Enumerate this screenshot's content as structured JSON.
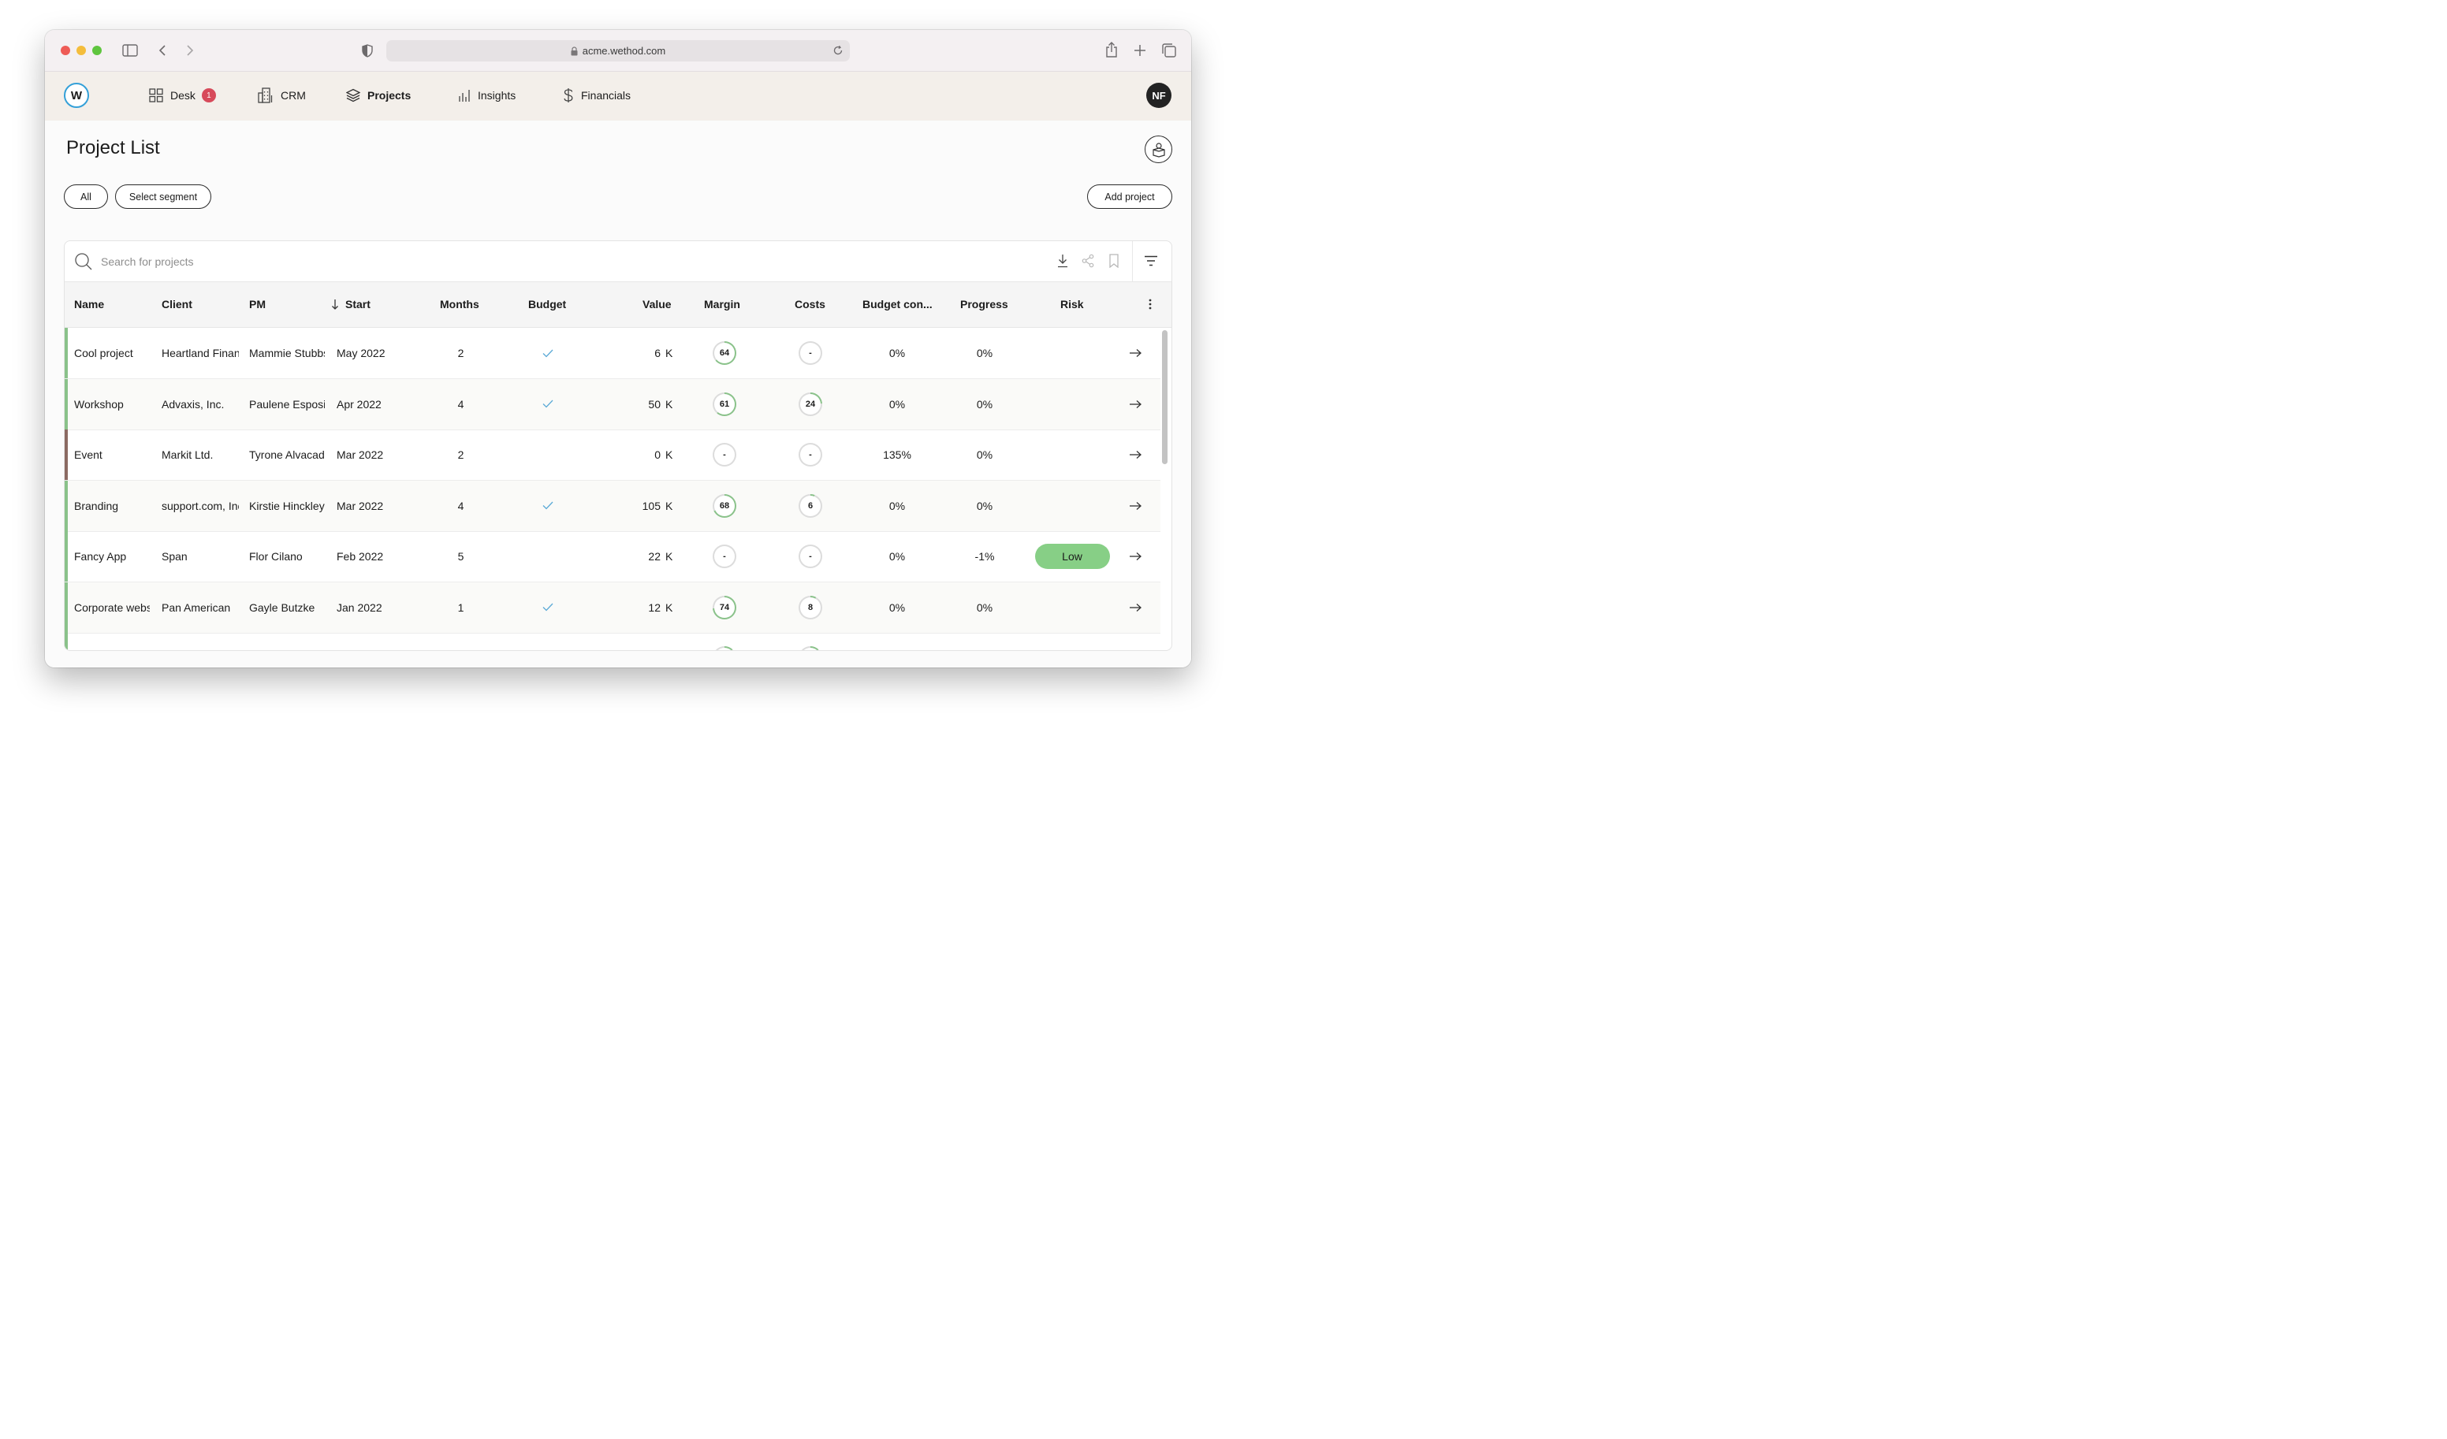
{
  "browser": {
    "url": "acme.wethod.com"
  },
  "nav": {
    "logo": "W",
    "items": [
      {
        "label": "Desk",
        "badge": "1",
        "icon": "grid-icon",
        "active": false
      },
      {
        "label": "CRM",
        "icon": "building-icon",
        "active": false
      },
      {
        "label": "Projects",
        "icon": "layers-icon",
        "active": true
      },
      {
        "label": "Insights",
        "icon": "bar-chart-icon",
        "active": false
      },
      {
        "label": "Financials",
        "icon": "dollar-icon",
        "active": false
      }
    ],
    "avatar_initials": "NF"
  },
  "page": {
    "title": "Project List",
    "filters": {
      "all_label": "All",
      "segment_label": "Select segment"
    },
    "add_project_label": "Add project"
  },
  "search": {
    "placeholder": "Search for projects",
    "value": ""
  },
  "table": {
    "columns": {
      "name": "Name",
      "client": "Client",
      "pm": "PM",
      "start": "Start",
      "months": "Months",
      "budget": "Budget",
      "value": "Value",
      "margin": "Margin",
      "costs": "Costs",
      "budget_consumption": "Budget con...",
      "progress": "Progress",
      "risk": "Risk"
    },
    "sort_column": "start",
    "sort_direction": "descending",
    "rows": [
      {
        "name": "Cool project",
        "client": "Heartland Financial",
        "pm": "Mammie Stubbs",
        "start": "May 2022",
        "months": "2",
        "budget_approved": true,
        "value": "6",
        "value_unit": "K",
        "margin": "64",
        "costs": "-",
        "budget_consumption": "0%",
        "progress": "0%",
        "risk": "",
        "status_color": "#8ac28a"
      },
      {
        "name": "Workshop",
        "client": "Advaxis, Inc.",
        "pm": "Paulene Esposito",
        "start": "Apr 2022",
        "months": "4",
        "budget_approved": true,
        "value": "50",
        "value_unit": "K",
        "margin": "61",
        "costs": "24",
        "budget_consumption": "0%",
        "progress": "0%",
        "risk": "",
        "status_color": "#8ac28a"
      },
      {
        "name": "Event",
        "client": "Markit Ltd.",
        "pm": "Tyrone Alvacado",
        "start": "Mar 2022",
        "months": "2",
        "budget_approved": false,
        "value": "0",
        "value_unit": "K",
        "margin": "-",
        "costs": "-",
        "budget_consumption": "135%",
        "progress": "0%",
        "risk": "",
        "status_color": "#8b6a62"
      },
      {
        "name": "Branding",
        "client": "support.com, Inc.",
        "pm": "Kirstie Hinckley",
        "start": "Mar 2022",
        "months": "4",
        "budget_approved": true,
        "value": "105",
        "value_unit": "K",
        "margin": "68",
        "costs": "6",
        "budget_consumption": "0%",
        "progress": "0%",
        "risk": "",
        "status_color": "#8ac28a"
      },
      {
        "name": "Fancy App",
        "client": "Span",
        "pm": "Flor Cilano",
        "start": "Feb 2022",
        "months": "5",
        "budget_approved": false,
        "value": "22",
        "value_unit": "K",
        "margin": "-",
        "costs": "-",
        "budget_consumption": "0%",
        "progress": "-1%",
        "risk": "Low",
        "status_color": "#8ac28a"
      },
      {
        "name": "Corporate website",
        "client": "Pan American",
        "pm": "Gayle Butzke",
        "start": "Jan 2022",
        "months": "1",
        "budget_approved": true,
        "value": "12",
        "value_unit": "K",
        "margin": "74",
        "costs": "8",
        "budget_consumption": "0%",
        "progress": "0%",
        "risk": "",
        "status_color": "#8ac28a"
      },
      {
        "name": "",
        "client": "",
        "pm": "",
        "start": "",
        "months": "",
        "budget_approved": false,
        "value": "",
        "value_unit": "",
        "margin": "",
        "costs": "",
        "budget_consumption": "",
        "progress": "",
        "risk": "",
        "status_color": "#8ac28a"
      }
    ]
  },
  "colors": {
    "accent_blue": "#34a0d8",
    "check_blue": "#5aa9d6",
    "ring_green": "#8ac28a",
    "risk_low": "#87cf86",
    "badge_red": "#d74a5a",
    "status_brown": "#8b6a62"
  }
}
